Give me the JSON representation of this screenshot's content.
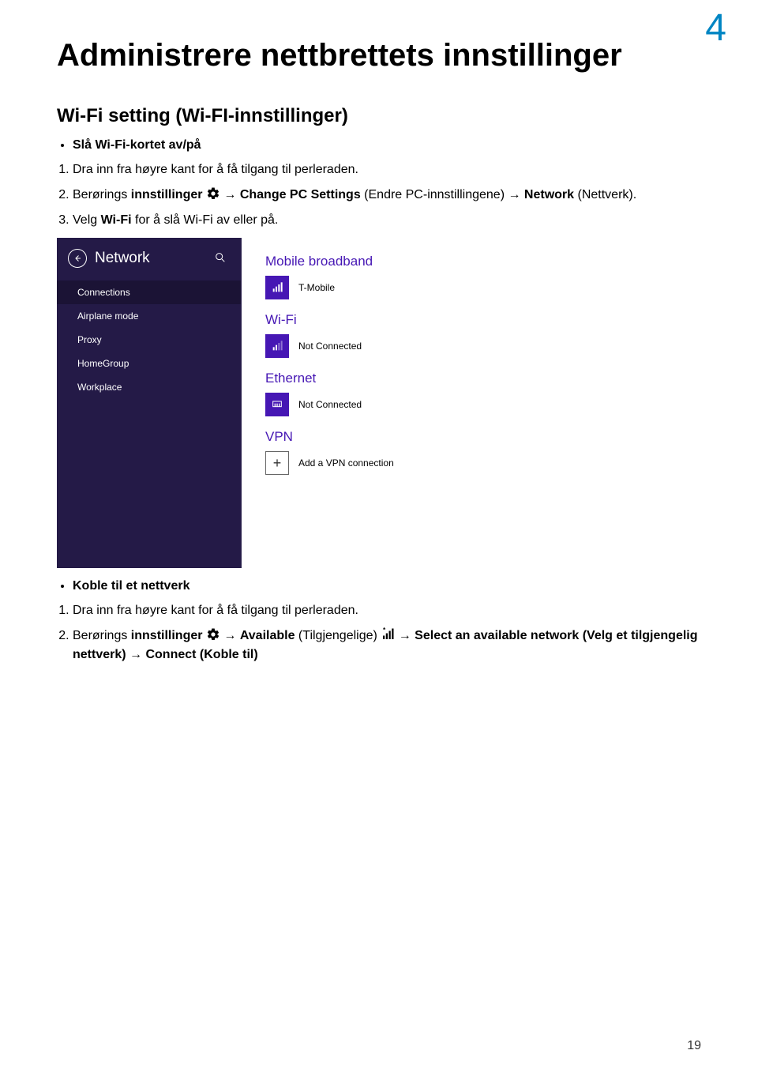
{
  "chapter_number": "4",
  "page_number": "19",
  "main_title": "Administrere nettbrettets innstillinger",
  "section1": {
    "title": "Wi-Fi setting (Wi-FI-innstillinger)",
    "bullet": "Slå Wi-Fi-kortet av/på",
    "step1": "Dra inn fra høyre kant for å få tilgang til perleraden.",
    "step2_pre": "Berørings ",
    "step2_bold1": "innstillinger",
    "step2_mid": " → ",
    "step2_bold2": "Change PC Settings",
    "step2_mid2": " (Endre PC-innstillingene) → ",
    "step2_bold3": "Network",
    "step2_end": " (Nettverk).",
    "step3_pre": "Velg ",
    "step3_bold": "Wi-Fi",
    "step3_end": " for å slå Wi-Fi av eller på."
  },
  "section2": {
    "bullet": "Koble til et nettverk",
    "step1": "Dra inn fra høyre kant for å få tilgang til perleraden.",
    "step2_pre": "Berørings ",
    "step2_bold1": "innstillinger",
    "step2_mid1": " → ",
    "step2_bold2": "Available",
    "step2_mid2": " (Tilgjengelige) ",
    "step2_mid3": " → ",
    "step2_bold3": "Select an available network (Velg et tilgjengelig nettverk)",
    "step2_mid4": " → ",
    "step2_bold4": "Connect (Koble til)"
  },
  "screenshot": {
    "title": "Network",
    "nav": [
      "Connections",
      "Airplane mode",
      "Proxy",
      "HomeGroup",
      "Workplace"
    ],
    "categories": [
      {
        "title": "Mobile broadband",
        "entries": [
          {
            "icon": "signal",
            "label": "T-Mobile"
          }
        ]
      },
      {
        "title": "Wi-Fi",
        "entries": [
          {
            "icon": "wifi",
            "label": "Not Connected"
          }
        ]
      },
      {
        "title": "Ethernet",
        "entries": [
          {
            "icon": "eth",
            "label": "Not Connected"
          }
        ]
      },
      {
        "title": "VPN",
        "entries": [
          {
            "icon": "plus",
            "label": "Add a VPN connection"
          }
        ]
      }
    ]
  }
}
